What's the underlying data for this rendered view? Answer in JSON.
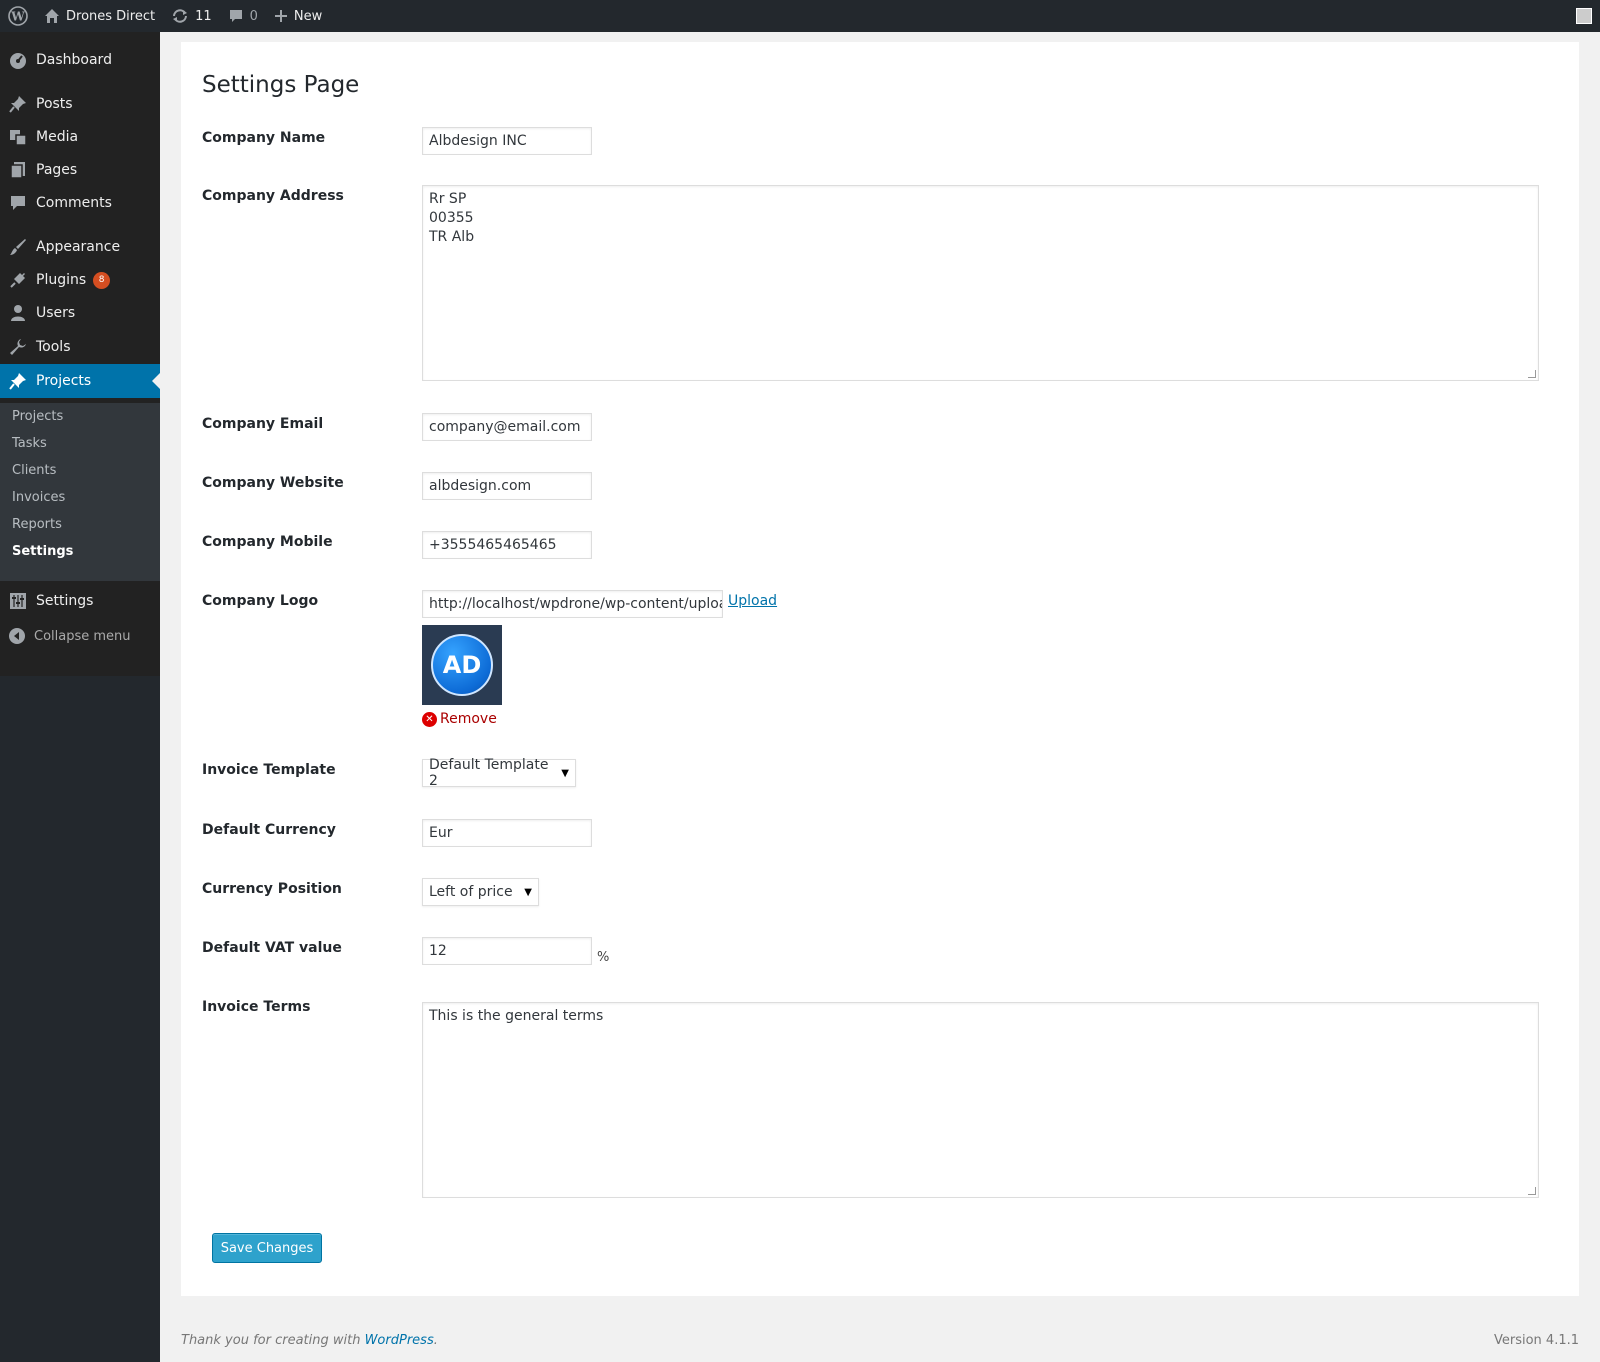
{
  "adminbar": {
    "site_name": "Drones Direct",
    "updates_count": "11",
    "comments_count": "0",
    "new_label": "New"
  },
  "sidebar": {
    "items": [
      {
        "label": "Dashboard",
        "icon": "dashboard-icon"
      },
      {
        "label": "Posts",
        "icon": "pin-icon"
      },
      {
        "label": "Media",
        "icon": "media-icon"
      },
      {
        "label": "Pages",
        "icon": "pages-icon"
      },
      {
        "label": "Comments",
        "icon": "comment-icon"
      },
      {
        "label": "Appearance",
        "icon": "brush-icon"
      },
      {
        "label": "Plugins",
        "icon": "plugin-icon",
        "badge": "8"
      },
      {
        "label": "Users",
        "icon": "user-icon"
      },
      {
        "label": "Tools",
        "icon": "wrench-icon"
      },
      {
        "label": "Projects",
        "icon": "pin-icon",
        "current": true
      },
      {
        "label": "Settings",
        "icon": "settings-icon"
      }
    ],
    "submenu": [
      "Projects",
      "Tasks",
      "Clients",
      "Invoices",
      "Reports",
      "Settings"
    ],
    "current_sub": "Settings",
    "collapse_label": "Collapse menu"
  },
  "page": {
    "title": "Settings Page"
  },
  "form": {
    "company_name_label": "Company Name",
    "company_name": "Albdesign INC",
    "company_address_label": "Company Address",
    "company_address": [
      "Rr SP",
      "00355",
      "TR Alb"
    ],
    "company_email_label": "Company Email",
    "company_email": "company@email.com",
    "company_website_label": "Company Website",
    "company_website": "albdesign.com",
    "company_mobile_label": "Company Mobile",
    "company_mobile": "+3555465465465",
    "company_logo_label": "Company Logo",
    "company_logo_url": "http://localhost/wpdrone/wp-content/uploads",
    "upload_label": "Upload",
    "logo_text": "AD",
    "remove_label": "Remove",
    "invoice_template_label": "Invoice Template",
    "invoice_template": "Default Template 2",
    "default_currency_label": "Default Currency",
    "default_currency": "Eur",
    "currency_position_label": "Currency Position",
    "currency_position": "Left of price",
    "vat_label": "Default VAT value",
    "vat_value": "12",
    "vat_unit": "%",
    "invoice_terms_label": "Invoice Terms",
    "invoice_terms": "This is the general terms",
    "save_label": "Save Changes"
  },
  "footer": {
    "thanks_prefix": "Thank you for creating with ",
    "wordpress_link": "WordPress",
    "thanks_suffix": ".",
    "version": "Version 4.1.1"
  },
  "colors": {
    "adminbar_bg": "#23282d",
    "accent": "#0073aa",
    "button": "#2ea2cc",
    "badge": "#d54e21"
  }
}
